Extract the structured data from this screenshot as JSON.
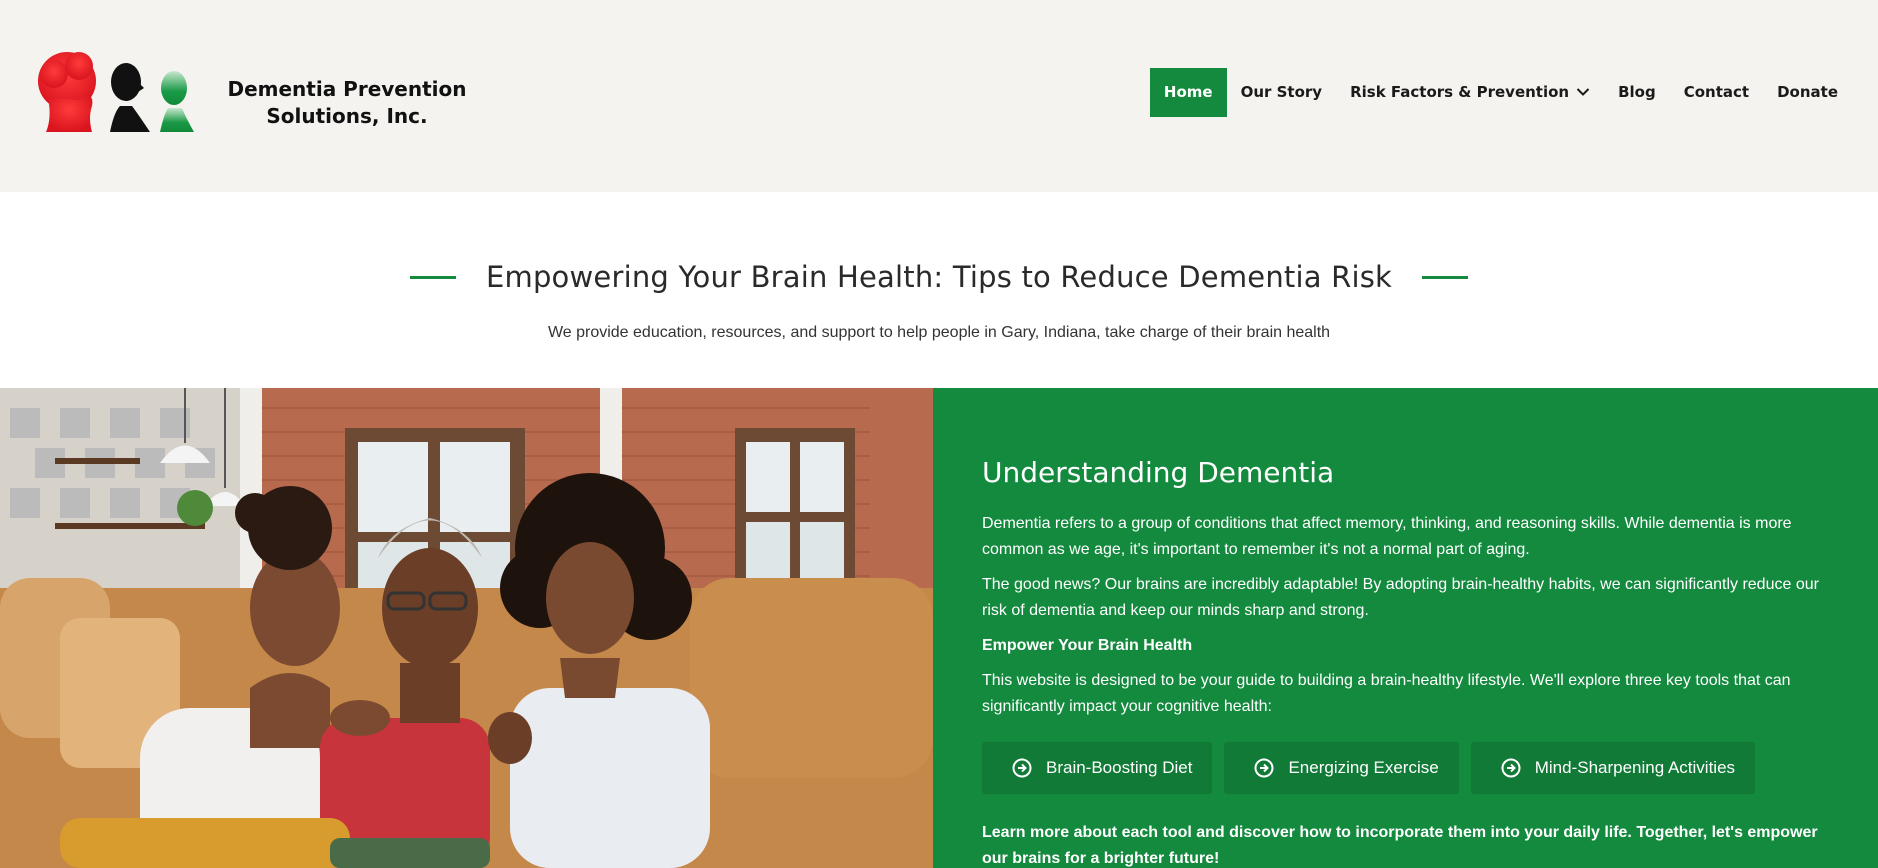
{
  "header": {
    "brand_line1": "Dementia Prevention",
    "brand_line2": "Solutions, Inc.",
    "logo_icon": "three-silhouettes-logo",
    "nav": {
      "items": [
        {
          "label": "Home",
          "active": true
        },
        {
          "label": "Our Story"
        },
        {
          "label": "Risk Factors & Prevention",
          "has_dropdown": true
        },
        {
          "label": "Blog"
        },
        {
          "label": "Contact"
        },
        {
          "label": "Donate"
        }
      ]
    }
  },
  "intro": {
    "title": "Empowering Your Brain Health: Tips to Reduce Dementia Risk",
    "subtitle": "We provide education, resources, and support to help people in Gary, Indiana, take charge of their brain health"
  },
  "feature": {
    "image_icon": "photo-three-women-on-sofa",
    "title": "Understanding Dementia",
    "p1": "Dementia refers to a group of conditions that affect memory, thinking, and reasoning skills. While dementia is more common as we age, it's important to remember it's not a normal part of aging.",
    "p2": "The good news? Our brains are incredibly adaptable! By adopting brain-healthy habits, we can significantly reduce our risk of dementia and keep our minds sharp and strong.",
    "p3": "Empower Your Brain Health",
    "p4": "This website is designed to be your guide to building a brain-healthy lifestyle. We'll explore three key tools that can significantly impact your cognitive health:",
    "tools": [
      {
        "label": "Brain-Boosting Diet",
        "icon": "arrow-circle-right-icon"
      },
      {
        "label": "Energizing Exercise",
        "icon": "arrow-circle-right-icon"
      },
      {
        "label": "Mind-Sharpening Activities",
        "icon": "arrow-circle-right-icon"
      }
    ],
    "cta": "Learn more about each tool and discover how to incorporate them into your daily life. Together, let's empower our brains for a brighter future!"
  },
  "colors": {
    "brand_green": "#138a3e",
    "header_bg": "#f5f3ef",
    "logo_red": "#e0202a",
    "logo_black": "#111111"
  }
}
